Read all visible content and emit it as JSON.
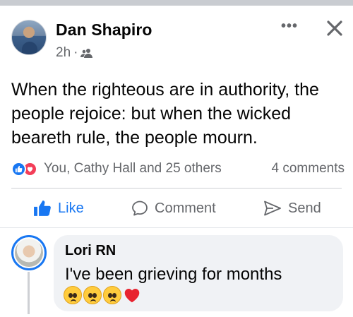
{
  "post": {
    "author": "Dan Shapiro",
    "time": "2h",
    "separator": "·",
    "audience_icon": "friends-icon",
    "more_label": "•••",
    "text": "When the righteous are in authority, the people rejoice: but when the wicked beareth rule, the people mourn.",
    "reactions_text": "You, Cathy Hall and 25 others",
    "comments_count": "4 comments"
  },
  "actions": {
    "like": "Like",
    "comment": "Comment",
    "send": "Send"
  },
  "comment": {
    "author": "Lori RN",
    "text": "I've been grieving for months",
    "emojis": [
      "pleading-face",
      "pleading-face",
      "pleading-face",
      "red-heart"
    ]
  },
  "colors": {
    "accent": "#1877f2",
    "love": "#f33e58",
    "muted_text": "#65676b"
  }
}
